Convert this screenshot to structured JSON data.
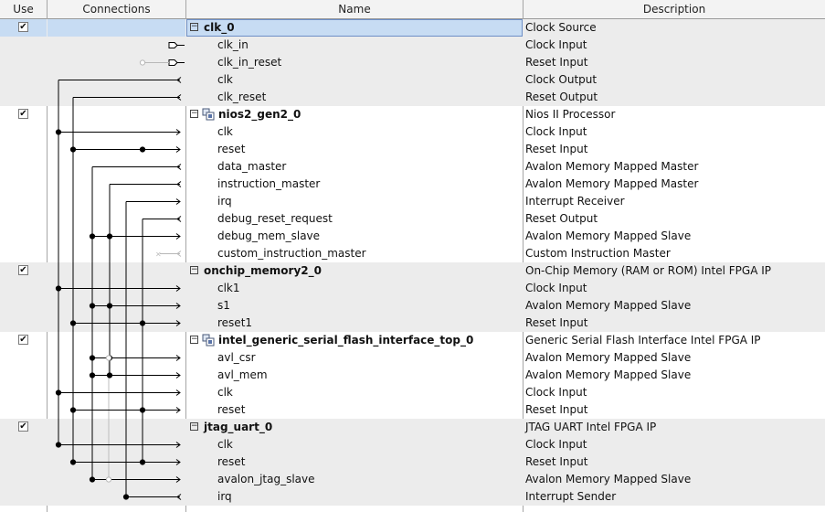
{
  "header": {
    "use": "Use",
    "connections": "Connections",
    "name": "Name",
    "description": "Description"
  },
  "rows": [
    {
      "kind": "module",
      "name": "clk_0",
      "desc": "Clock Source",
      "checked": true,
      "icon": false,
      "selected": true
    },
    {
      "kind": "iface",
      "name": "clk_in",
      "desc": "Clock Input"
    },
    {
      "kind": "iface",
      "name": "clk_in_reset",
      "desc": "Reset Input"
    },
    {
      "kind": "iface",
      "name": "clk",
      "desc": "Clock Output"
    },
    {
      "kind": "iface",
      "name": "clk_reset",
      "desc": "Reset Output"
    },
    {
      "kind": "module",
      "name": "nios2_gen2_0",
      "desc": "Nios II Processor",
      "checked": true,
      "icon": true
    },
    {
      "kind": "iface",
      "name": "clk",
      "desc": "Clock Input"
    },
    {
      "kind": "iface",
      "name": "reset",
      "desc": "Reset Input"
    },
    {
      "kind": "iface",
      "name": "data_master",
      "desc": "Avalon Memory Mapped Master"
    },
    {
      "kind": "iface",
      "name": "instruction_master",
      "desc": "Avalon Memory Mapped Master"
    },
    {
      "kind": "iface",
      "name": "irq",
      "desc": "Interrupt Receiver"
    },
    {
      "kind": "iface",
      "name": "debug_reset_request",
      "desc": "Reset Output"
    },
    {
      "kind": "iface",
      "name": "debug_mem_slave",
      "desc": "Avalon Memory Mapped Slave"
    },
    {
      "kind": "iface",
      "name": "custom_instruction_master",
      "desc": "Custom Instruction Master"
    },
    {
      "kind": "module",
      "name": "onchip_memory2_0",
      "desc": "On-Chip Memory (RAM or ROM) Intel FPGA IP",
      "checked": true,
      "icon": false
    },
    {
      "kind": "iface",
      "name": "clk1",
      "desc": "Clock Input"
    },
    {
      "kind": "iface",
      "name": "s1",
      "desc": "Avalon Memory Mapped Slave"
    },
    {
      "kind": "iface",
      "name": "reset1",
      "desc": "Reset Input"
    },
    {
      "kind": "module",
      "name": "intel_generic_serial_flash_interface_top_0",
      "desc": "Generic Serial Flash Interface Intel FPGA IP",
      "checked": true,
      "icon": true
    },
    {
      "kind": "iface",
      "name": "avl_csr",
      "desc": "Avalon Memory Mapped Slave"
    },
    {
      "kind": "iface",
      "name": "avl_mem",
      "desc": "Avalon Memory Mapped Slave"
    },
    {
      "kind": "iface",
      "name": "clk",
      "desc": "Clock Input"
    },
    {
      "kind": "iface",
      "name": "reset",
      "desc": "Reset Input"
    },
    {
      "kind": "module",
      "name": "jtag_uart_0",
      "desc": "JTAG UART Intel FPGA IP",
      "checked": true,
      "icon": false
    },
    {
      "kind": "iface",
      "name": "clk",
      "desc": "Clock Input"
    },
    {
      "kind": "iface",
      "name": "reset",
      "desc": "Reset Input"
    },
    {
      "kind": "iface",
      "name": "avalon_jtag_slave",
      "desc": "Avalon Memory Mapped Slave"
    },
    {
      "kind": "iface",
      "name": "irq",
      "desc": "Interrupt Sender"
    }
  ]
}
